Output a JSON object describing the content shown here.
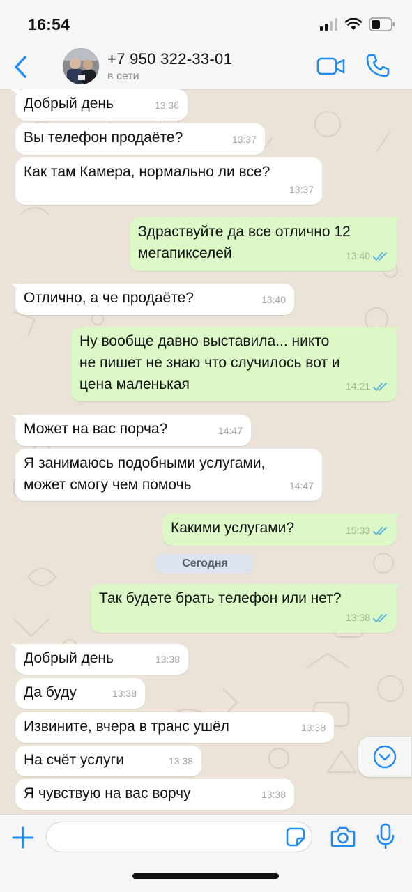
{
  "status_bar": {
    "time": "16:54"
  },
  "header": {
    "contact_name": "+7 950 322-33-01",
    "contact_status": "в сети"
  },
  "colors": {
    "incoming_bubble": "#ffffff",
    "outgoing_bubble": "#dcf8c6",
    "accent": "#1f8bf4",
    "read_ticks": "#4fb0e8"
  },
  "messages": [
    {
      "direction": "in",
      "text": "Добрый день",
      "time": "13:36"
    },
    {
      "direction": "in",
      "text": "Вы телефон продаёте?",
      "time": "13:37"
    },
    {
      "direction": "in",
      "text": "Как там Камера, нормально ли все?",
      "time": "13:37"
    },
    {
      "direction": "out",
      "text": "Здраствуйте да все отлично 12\nмегапикселей",
      "time": "13:40",
      "read": true
    },
    {
      "direction": "in",
      "text": "Отлично, а че продаёте?",
      "time": "13:40"
    },
    {
      "direction": "out",
      "text": "Ну вообще давно выставила... никто\nне пишет не знаю что случилось вот и\nцена маленькая",
      "time": "14:21",
      "read": true
    },
    {
      "direction": "in",
      "text": "Может на вас порча?",
      "time": "14:47"
    },
    {
      "direction": "in",
      "text": "Я занимаюсь подобными услугами,\nможет смогу чем помочь",
      "time": "14:47"
    },
    {
      "direction": "out",
      "text": "Какими услугами?",
      "time": "15:33",
      "read": true
    },
    {
      "direction": "out",
      "text": "Так будете брать телефон или нет?",
      "time": "13:38",
      "read": true
    },
    {
      "direction": "in",
      "text": "Добрый день",
      "time": "13:38"
    },
    {
      "direction": "in",
      "text": "Да буду",
      "time": "13:38"
    },
    {
      "direction": "in",
      "text": "Извините, вчера в транс ушёл",
      "time": "13:38"
    },
    {
      "direction": "in",
      "text": "На счёт услуги",
      "time": "13:38"
    },
    {
      "direction": "in",
      "text": "Я чувствую на вас ворчу",
      "time": "13:38"
    }
  ],
  "date_separator": "Сегодня",
  "input": {
    "placeholder": ""
  },
  "icons": {
    "back": "chevron-left-icon",
    "video": "video-camera-icon",
    "call": "phone-icon",
    "add": "plus-icon",
    "sticker": "sticker-icon",
    "camera": "camera-icon",
    "mic": "microphone-icon",
    "scroll_down": "chevron-down-circle-icon",
    "read": "double-check-icon"
  }
}
